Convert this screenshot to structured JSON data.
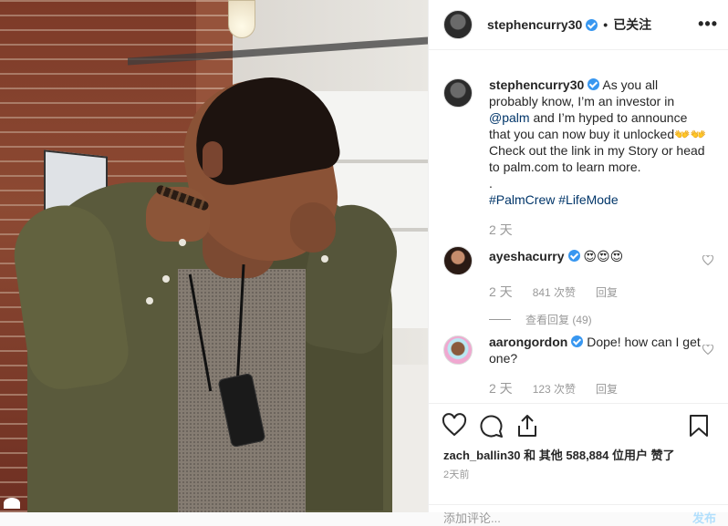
{
  "post": {
    "author": "stephencurry30",
    "follow_label": "已关注",
    "dot": "•",
    "more_label": "•••"
  },
  "caption": {
    "username": "stephencurry30",
    "text_parts": [
      "As you all probably know, I’m an investor in ",
      "@palm",
      " and I’m hyped to announce that you can now buy it unlocked👐👐 Check out the link in my Story or head to palm.com to learn more.",
      "\n.\n",
      "#PalmCrew",
      " ",
      "#LifeMode"
    ],
    "time": "2 天"
  },
  "comments": [
    {
      "username": "ayeshacurry",
      "text": "😍😍😍",
      "time": "2 天",
      "likes": "841 次赞",
      "reply": "回复",
      "view_replies": "查看回复 (49)"
    },
    {
      "username": "aarongordon",
      "text": "Dope! how can I get one?",
      "time": "2 天",
      "likes": "123 次赞",
      "reply": "回复"
    }
  ],
  "actions": {
    "icons": [
      "heart-icon",
      "comment-icon",
      "share-icon",
      "bookmark-icon"
    ],
    "likes_text": "zach_ballin30 和 其他 588,884 位用户 赞了",
    "time": "2天前"
  },
  "add_comment": {
    "placeholder": "添加评论...",
    "post_label": "发布"
  },
  "colors": {
    "verified": "#3897f0",
    "link": "#003569",
    "muted": "#999999",
    "border": "#efefef"
  }
}
